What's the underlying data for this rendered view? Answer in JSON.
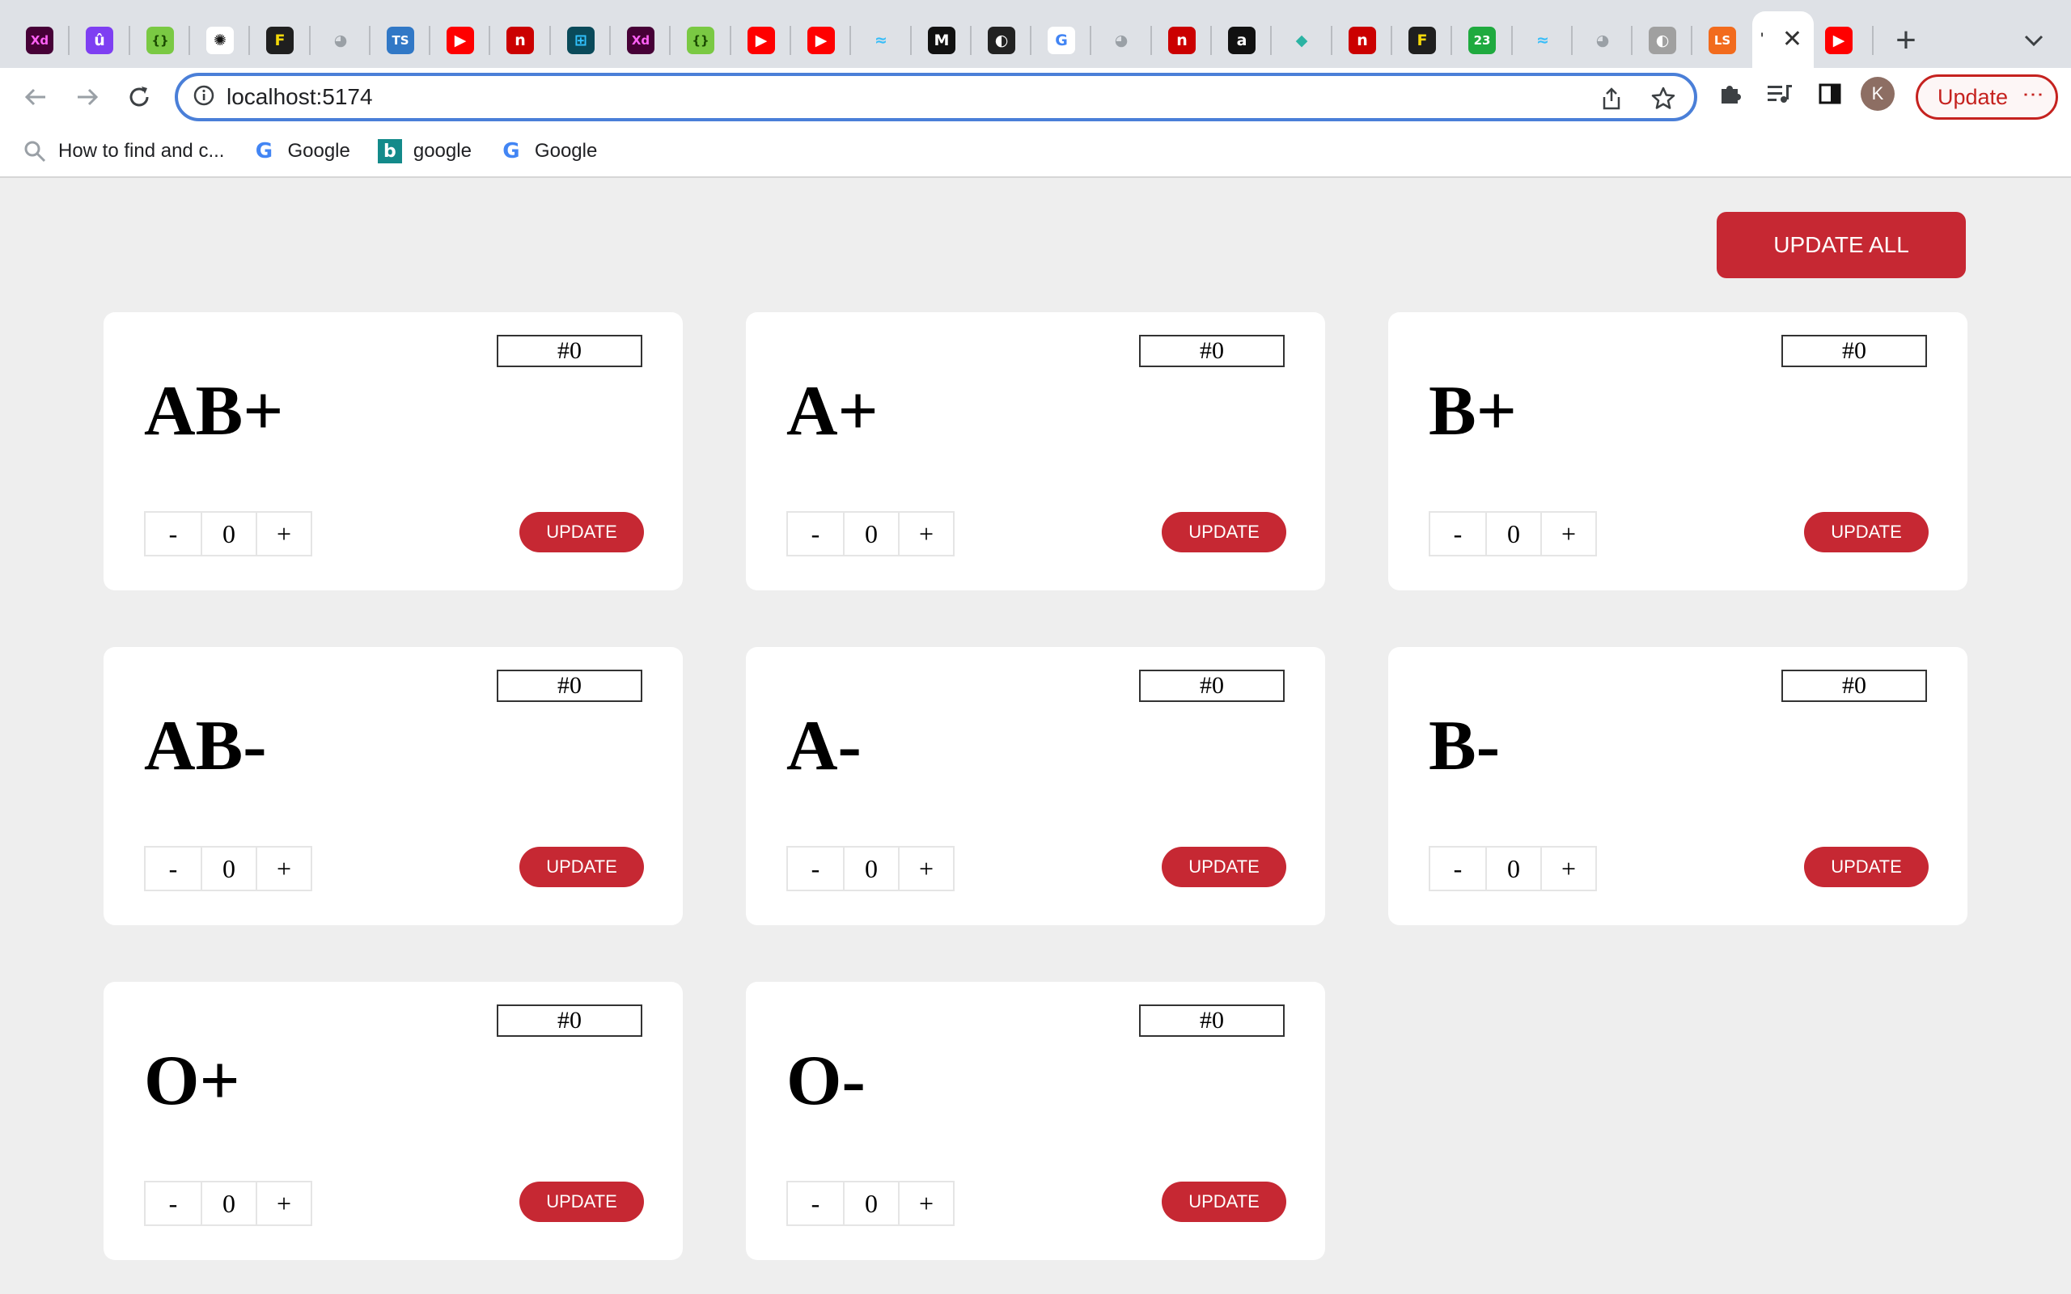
{
  "browser": {
    "tabs": [
      {
        "icon": "adobe-xd-icon",
        "glyph": "Xd",
        "color": "#470137",
        "fg": "#ff61f6"
      },
      {
        "icon": "u-circle-icon",
        "glyph": "û",
        "color": "#7e3ff2",
        "fg": "#ffffff"
      },
      {
        "icon": "braces-icon",
        "glyph": "{}",
        "color": "#7ac943",
        "fg": "#1b4b00"
      },
      {
        "icon": "openai-icon",
        "glyph": "✺",
        "color": "#ffffff",
        "fg": "#111111"
      },
      {
        "icon": "f-icon",
        "glyph": "F",
        "color": "#1f1f1f",
        "fg": "#f5d90a"
      },
      {
        "icon": "github-icon",
        "glyph": "◕",
        "color": "#dee1e6",
        "fg": "#9aa0a6"
      },
      {
        "icon": "typescript-icon",
        "glyph": "TS",
        "color": "#3178c6",
        "fg": "#ffffff"
      },
      {
        "icon": "youtube-icon",
        "glyph": "▶",
        "color": "#ff0000",
        "fg": "#ffffff"
      },
      {
        "icon": "npm-icon",
        "glyph": "n",
        "color": "#cb0000",
        "fg": "#ffffff"
      },
      {
        "icon": "diagram-icon",
        "glyph": "⊞",
        "color": "#0a4a5a",
        "fg": "#31c2ff"
      },
      {
        "icon": "adobe-xd-icon",
        "glyph": "Xd",
        "color": "#470137",
        "fg": "#ff61f6"
      },
      {
        "icon": "braces-icon",
        "glyph": "{}",
        "color": "#7ac943",
        "fg": "#1b4b00"
      },
      {
        "icon": "youtube-icon",
        "glyph": "▶",
        "color": "#ff0000",
        "fg": "#ffffff"
      },
      {
        "icon": "youtube-icon",
        "glyph": "▶",
        "color": "#ff0000",
        "fg": "#ffffff"
      },
      {
        "icon": "tailwind-icon",
        "glyph": "≈",
        "color": "#dee1e6",
        "fg": "#38bdf8"
      },
      {
        "icon": "m-icon",
        "glyph": "M",
        "color": "#111111",
        "fg": "#ffffff"
      },
      {
        "icon": "globe-icon",
        "glyph": "◐",
        "color": "#222222",
        "fg": "#ffffff"
      },
      {
        "icon": "google-icon",
        "glyph": "G",
        "color": "#ffffff",
        "fg": "#4285f4"
      },
      {
        "icon": "github-icon",
        "glyph": "◕",
        "color": "#dee1e6",
        "fg": "#9aa0a6"
      },
      {
        "icon": "npm-icon",
        "glyph": "n",
        "color": "#cb0000",
        "fg": "#ffffff"
      },
      {
        "icon": "a-diamond-icon",
        "glyph": "a",
        "color": "#111111",
        "fg": "#ffffff"
      },
      {
        "icon": "diamond-icon",
        "glyph": "◆",
        "color": "#dee1e6",
        "fg": "#2bb3a3"
      },
      {
        "icon": "npm-icon",
        "glyph": "n",
        "color": "#cb0000",
        "fg": "#ffffff"
      },
      {
        "icon": "f-icon",
        "glyph": "F",
        "color": "#1f1f1f",
        "fg": "#f5d90a"
      },
      {
        "icon": "badge-23-icon",
        "glyph": "23",
        "color": "#1faa3f",
        "fg": "#ffffff"
      },
      {
        "icon": "tailwind-icon",
        "glyph": "≈",
        "color": "#dee1e6",
        "fg": "#38bdf8"
      },
      {
        "icon": "github-icon",
        "glyph": "◕",
        "color": "#dee1e6",
        "fg": "#9aa0a6"
      },
      {
        "icon": "globe-grey-icon",
        "glyph": "◐",
        "color": "#a0a0a0",
        "fg": "#ffffff"
      },
      {
        "icon": "ls-icon",
        "glyph": "LS",
        "color": "#f26b1d",
        "fg": "#ffffff"
      }
    ],
    "active_tab_glyph": "'",
    "last_tab": {
      "icon": "youtube-icon",
      "glyph": "▶",
      "color": "#ff0000",
      "fg": "#ffffff"
    },
    "url": "localhost:5174",
    "profile_initial": "K",
    "update_label": "Update",
    "bookmarks": [
      {
        "icon": "search-icon",
        "label": "How to find and c..."
      },
      {
        "icon": "google-icon",
        "label": "Google"
      },
      {
        "icon": "bing-icon",
        "label": "google"
      },
      {
        "icon": "google-icon",
        "label": "Google"
      }
    ]
  },
  "page": {
    "update_all_label": "UPDATE ALL",
    "accent": "#c62833",
    "cards": [
      {
        "group": "AB+",
        "badge": "#0",
        "minus": "-",
        "count": "0",
        "plus": "+",
        "update_label": "UPDATE"
      },
      {
        "group": "A+",
        "badge": "#0",
        "minus": "-",
        "count": "0",
        "plus": "+",
        "update_label": "UPDATE"
      },
      {
        "group": "B+",
        "badge": "#0",
        "minus": "-",
        "count": "0",
        "plus": "+",
        "update_label": "UPDATE"
      },
      {
        "group": "AB-",
        "badge": "#0",
        "minus": "-",
        "count": "0",
        "plus": "+",
        "update_label": "UPDATE"
      },
      {
        "group": "A-",
        "badge": "#0",
        "minus": "-",
        "count": "0",
        "plus": "+",
        "update_label": "UPDATE"
      },
      {
        "group": "B-",
        "badge": "#0",
        "minus": "-",
        "count": "0",
        "plus": "+",
        "update_label": "UPDATE"
      },
      {
        "group": "O+",
        "badge": "#0",
        "minus": "-",
        "count": "0",
        "plus": "+",
        "update_label": "UPDATE"
      },
      {
        "group": "O-",
        "badge": "#0",
        "minus": "-",
        "count": "0",
        "plus": "+",
        "update_label": "UPDATE"
      }
    ]
  }
}
